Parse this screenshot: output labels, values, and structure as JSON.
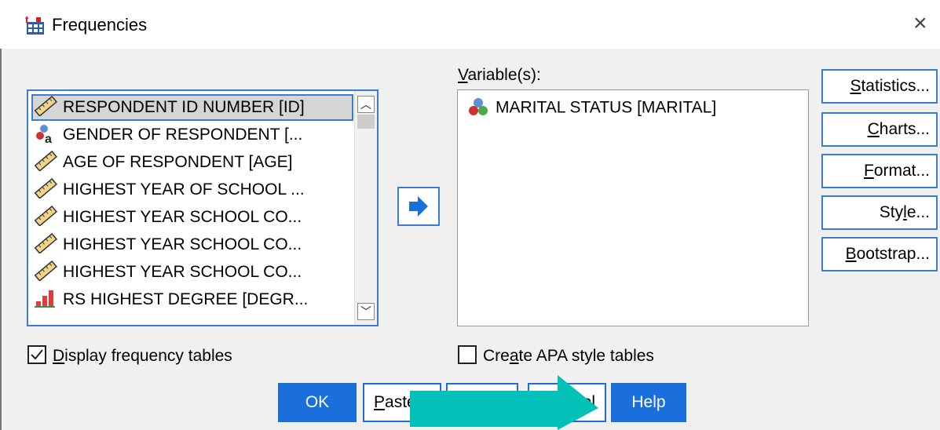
{
  "window": {
    "title": "Frequencies",
    "close_glyph": "×"
  },
  "source_list": {
    "items": [
      {
        "label": "RESPONDENT ID NUMBER [ID]",
        "icon": "scale-ruler-icon",
        "selected": true
      },
      {
        "label": "GENDER OF RESPONDENT [...",
        "icon": "nominal-string-icon"
      },
      {
        "label": "AGE OF RESPONDENT [AGE]",
        "icon": "scale-ruler-icon"
      },
      {
        "label": "HIGHEST YEAR OF SCHOOL ...",
        "icon": "scale-ruler-icon"
      },
      {
        "label": "HIGHEST YEAR SCHOOL CO...",
        "icon": "scale-ruler-icon"
      },
      {
        "label": "HIGHEST YEAR SCHOOL CO...",
        "icon": "scale-ruler-icon"
      },
      {
        "label": "HIGHEST YEAR SCHOOL CO...",
        "icon": "scale-ruler-icon"
      },
      {
        "label": "RS HIGHEST DEGREE [DEGR...",
        "icon": "ordinal-bars-icon"
      }
    ]
  },
  "variables": {
    "label_first": "V",
    "label_rest": "ariable(s):",
    "items": [
      {
        "label": "MARITAL STATUS [MARITAL]",
        "icon": "nominal-icon"
      }
    ]
  },
  "side_buttons": {
    "statistics": {
      "mn": "S",
      "rest": "tatistics..."
    },
    "charts": {
      "mn": "C",
      "rest": "harts..."
    },
    "format": {
      "mn": "F",
      "rest": "ormat..."
    },
    "style": {
      "pre": "Sty",
      "mn": "l",
      "rest": "e..."
    },
    "bootstrap": {
      "mn": "B",
      "rest": "ootstrap..."
    }
  },
  "checkboxes": {
    "display_freq": {
      "mn": "D",
      "rest": "isplay frequency tables",
      "checked": true
    },
    "apa": {
      "pre": "Cre",
      "mn": "a",
      "rest": "te APA style tables",
      "checked": false
    }
  },
  "buttons": {
    "ok": "OK",
    "paste": {
      "mn": "P",
      "rest": "aste"
    },
    "cancel_visible": "el",
    "help": "Help"
  },
  "colors": {
    "accent": "#1a6fdd",
    "focus_border": "#3d7bd9",
    "overlay_arrow": "#00c0b8"
  }
}
